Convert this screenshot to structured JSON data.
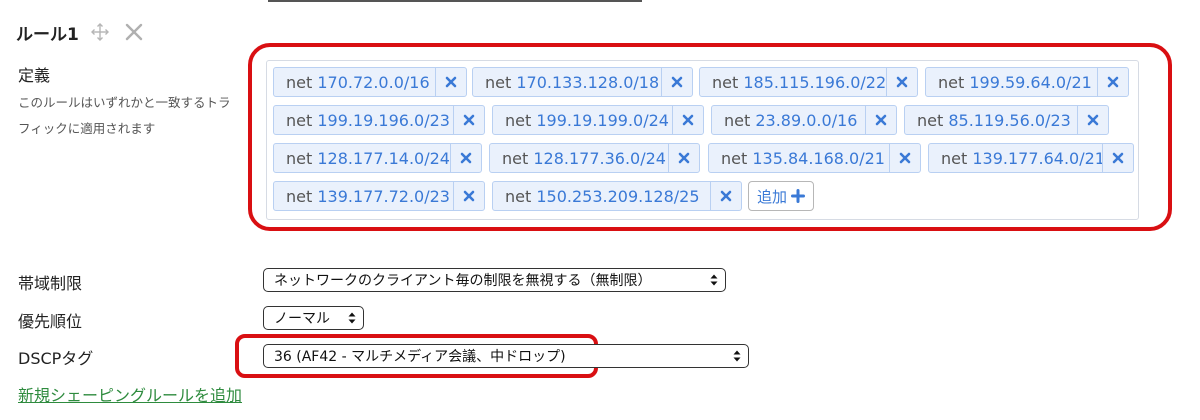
{
  "rule": {
    "title": "ルール1"
  },
  "definition": {
    "label": "定義",
    "description": "このルールはいずれかと一致するトラフィックに適用されます",
    "add_label": "追加",
    "tags": [
      {
        "prefix": "net",
        "ip": "170.72.0.0/16"
      },
      {
        "prefix": "net",
        "ip": "170.133.128.0/18"
      },
      {
        "prefix": "net",
        "ip": "185.115.196.0/22"
      },
      {
        "prefix": "net",
        "ip": "199.59.64.0/21"
      },
      {
        "prefix": "net",
        "ip": "199.19.196.0/23"
      },
      {
        "prefix": "net",
        "ip": "199.19.199.0/24"
      },
      {
        "prefix": "net",
        "ip": "23.89.0.0/16"
      },
      {
        "prefix": "net",
        "ip": "85.119.56.0/23"
      },
      {
        "prefix": "net",
        "ip": "128.177.14.0/24"
      },
      {
        "prefix": "net",
        "ip": "128.177.36.0/24"
      },
      {
        "prefix": "net",
        "ip": "135.84.168.0/21"
      },
      {
        "prefix": "net",
        "ip": "139.177.64.0/21"
      },
      {
        "prefix": "net",
        "ip": "139.177.72.0/23"
      },
      {
        "prefix": "net",
        "ip": "150.253.209.128/25"
      }
    ]
  },
  "bandwidth": {
    "label": "帯域制限",
    "selected": "ネットワークのクライアント毎の制限を無視する（無制限）"
  },
  "priority": {
    "label": "優先順位",
    "selected": "ノーマル"
  },
  "dscp": {
    "label": "DSCPタグ",
    "selected": "36 (AF42 - マルチメディア会議、中ドロップ)"
  },
  "footer": {
    "add_rule_link": "新規シェーピングルールを追加"
  },
  "colors": {
    "highlight": "#d90f12",
    "tag_background": "#eaf1fc",
    "tag_text": "#3a79d6",
    "link": "#2e8b3e"
  },
  "icons": {
    "move": "move-arrows-icon",
    "close": "close-x-icon",
    "tag_remove": "x-icon",
    "add": "plus-icon",
    "select_arrows": "up-down-arrows-icon"
  }
}
